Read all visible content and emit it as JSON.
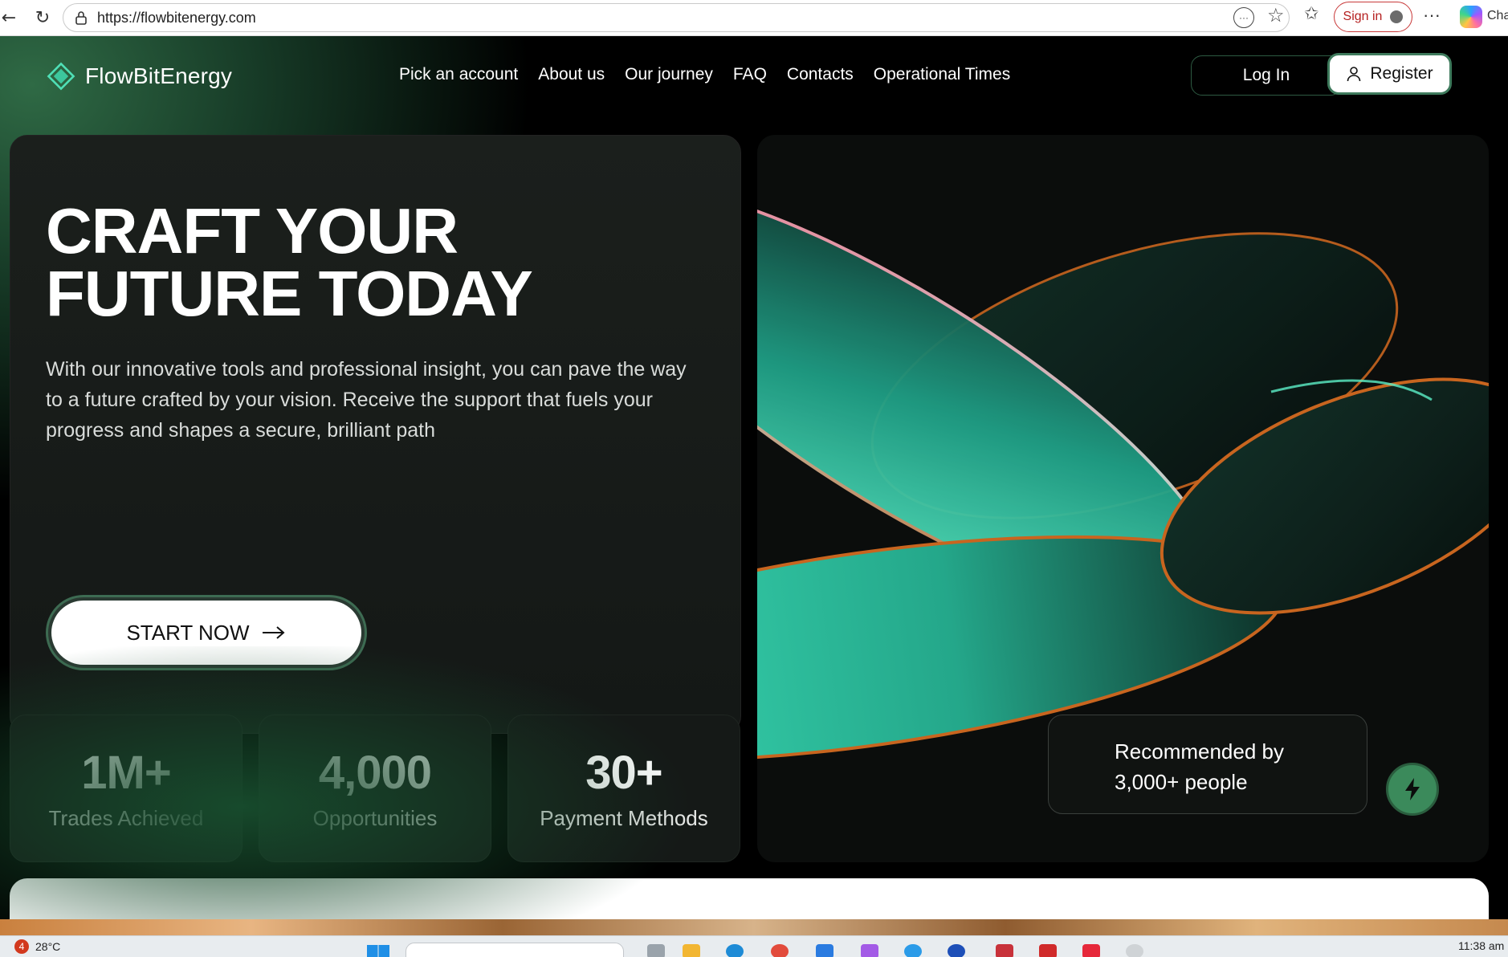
{
  "browser": {
    "url": "https://flowbitenergy.com",
    "signin_label": "Sign in",
    "more_label": "···",
    "copilot_label": "Cha"
  },
  "nav": {
    "logo_text": "FlowBitEnergy",
    "links": [
      "Pick an account",
      "About us",
      "Our journey",
      "FAQ",
      "Contacts",
      "Operational Times"
    ],
    "login_label": "Log In",
    "register_label": "Register"
  },
  "hero": {
    "title_line1": "CRAFT YOUR",
    "title_line2": "FUTURE TODAY",
    "description": "With our innovative tools and professional insight, you can pave the way to a future crafted by your vision. Receive the support that fuels your progress and shapes a secure, brilliant path",
    "cta_label": "START NOW"
  },
  "stats": [
    {
      "value": "1M+",
      "label": "Trades Achieved"
    },
    {
      "value": "4,000",
      "label": "Opportunities"
    },
    {
      "value": "30+",
      "label": "Payment Methods"
    }
  ],
  "recommendation": {
    "line1": "Recommended by",
    "line2": "3,000+ people"
  },
  "taskbar": {
    "weather_badge": "4",
    "temperature": "28°C",
    "time": "11:38 am"
  },
  "colors": {
    "accent_green": "#3b8a5b",
    "teal": "#3fe0b8",
    "orange": "#c8651f"
  }
}
